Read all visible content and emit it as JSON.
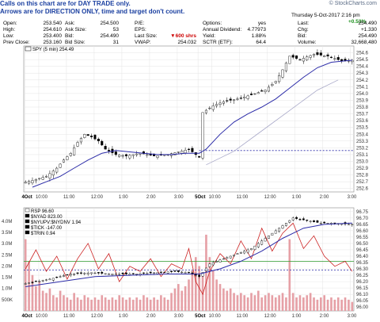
{
  "banner": {
    "line1": "Calls on this chart are for DAY TRADE only.",
    "line2": "Arrows are for DIRECTION ONLY, time and target don't count."
  },
  "brand": "© StockCharts.com",
  "quote": {
    "date": "Thursday  5-Oct-2017  2:16 pm",
    "change_pct": "+0.53%",
    "rows": [
      {
        "l1": "Open:",
        "v1": "253.540",
        "l2": "Ask:",
        "v2": "254.500",
        "l3": "P/E:",
        "v3": "",
        "l4": "Options:",
        "v4": "yes",
        "l5": "Last:",
        "v5": "254.490"
      },
      {
        "l1": "High:",
        "v1": "254.610",
        "l2": "Ask Size:",
        "v2": "53",
        "l3": "EPS:",
        "v3": "",
        "l4": "Annual Dividend:",
        "v4": "4.77973",
        "l5": "Chg:",
        "v5": "+1.330"
      },
      {
        "l1": "Low:",
        "v1": "253.400",
        "l2": "Bid:",
        "v2": "254.490",
        "l3": "Last Size:",
        "v3": "600 shrs",
        "l4": "Yield:",
        "v4": "1.88%",
        "l5": "Bid:",
        "v5": "254.490"
      },
      {
        "l1": "Prev Close:",
        "v1": "253.160",
        "l2": "Bid Size:",
        "v2": "31",
        "l3": "VWAP:",
        "v3": "254.032",
        "l4": "SCTR (ETF):",
        "v4": "64.4",
        "l5": "Volume:",
        "v5": "32,668,480"
      }
    ]
  },
  "colors": {
    "ma": "#2c2ca8",
    "prev_close_line": "#2c2ca8",
    "red_line": "#cc2222",
    "green_line": "#2a9a2a",
    "volume": "#e6a0a6",
    "candle_up": "#ffffff",
    "candle_down": "#000000"
  },
  "chart_data": [
    {
      "type": "candlestick",
      "legend": "SPY (5 min) 254.49",
      "ylim": [
        252.55,
        254.7
      ],
      "y_ticks": [
        252.6,
        252.7,
        252.8,
        252.9,
        253.0,
        253.1,
        253.2,
        253.3,
        253.4,
        253.5,
        253.6,
        253.7,
        253.8,
        253.9,
        254.0,
        254.1,
        254.2,
        254.3,
        254.4,
        254.5,
        254.6
      ],
      "x_ticks": [
        "4Oct",
        "10:00",
        "11:00",
        "12:00",
        "1:00",
        "2:00",
        "3:00",
        "5Oct",
        "10:00",
        "11:00",
        "12:00",
        "1:00",
        "2:00",
        "3:00"
      ],
      "prev_close": 253.16,
      "price_path": [
        [
          0,
          252.68
        ],
        [
          3,
          252.72
        ],
        [
          7,
          252.78
        ],
        [
          10,
          252.9
        ],
        [
          12,
          253.02
        ],
        [
          14,
          253.12
        ],
        [
          16,
          253.28
        ],
        [
          18,
          253.4
        ],
        [
          20,
          253.36
        ],
        [
          22,
          253.3
        ],
        [
          24,
          253.18
        ],
        [
          27,
          253.1
        ],
        [
          30,
          253.08
        ],
        [
          34,
          253.12
        ],
        [
          38,
          253.08
        ],
        [
          42,
          253.1
        ],
        [
          45,
          253.14
        ],
        [
          48,
          253.18
        ],
        [
          51,
          253.06
        ],
        [
          52,
          253.72
        ],
        [
          55,
          253.82
        ],
        [
          58,
          253.88
        ],
        [
          62,
          253.92
        ],
        [
          66,
          253.98
        ],
        [
          70,
          254.05
        ],
        [
          73,
          254.18
        ],
        [
          75,
          254.35
        ],
        [
          77,
          254.55
        ],
        [
          80,
          254.5
        ],
        [
          84,
          254.58
        ],
        [
          88,
          254.55
        ],
        [
          92,
          254.48
        ],
        [
          94,
          254.49
        ]
      ],
      "ma_path": [
        [
          2,
          252.62
        ],
        [
          6,
          252.7
        ],
        [
          10,
          252.78
        ],
        [
          14,
          252.9
        ],
        [
          18,
          253.02
        ],
        [
          22,
          253.12
        ],
        [
          26,
          253.16
        ],
        [
          30,
          253.14
        ],
        [
          34,
          253.12
        ],
        [
          38,
          253.1
        ],
        [
          42,
          253.1
        ],
        [
          46,
          253.12
        ],
        [
          50,
          253.12
        ],
        [
          52,
          253.18
        ],
        [
          56,
          253.4
        ],
        [
          60,
          253.58
        ],
        [
          64,
          253.7
        ],
        [
          68,
          253.8
        ],
        [
          72,
          253.92
        ],
        [
          76,
          254.08
        ],
        [
          80,
          254.24
        ],
        [
          84,
          254.38
        ],
        [
          88,
          254.46
        ],
        [
          92,
          254.48
        ],
        [
          94,
          254.49
        ]
      ],
      "ma_shadow_path": [
        [
          52,
          252.95
        ],
        [
          60,
          253.15
        ],
        [
          68,
          253.45
        ],
        [
          76,
          253.75
        ],
        [
          84,
          254.05
        ],
        [
          90,
          254.2
        ]
      ]
    },
    {
      "type": "line",
      "legend": [
        "RSP 96.60",
        "$NYAD 823.00",
        "$NYUPV:$NYDNV 1.94",
        "$TICK -147.00",
        "$TRIN 0.94"
      ],
      "ylim": [
        95.97,
        96.78
      ],
      "y_ticks": [
        96.0,
        96.05,
        96.1,
        96.15,
        96.2,
        96.25,
        96.3,
        96.35,
        96.4,
        96.45,
        96.5,
        96.55,
        96.6,
        96.65,
        96.7,
        96.75
      ],
      "left_ticks": [
        "500K",
        "1.0M",
        "1.5M",
        "2.0M",
        "2.5M",
        "3.0M",
        "3.5M",
        "4.0M"
      ],
      "x_ticks": [
        "4Oct",
        "10:00",
        "11:00",
        "12:00",
        "1:00",
        "2:00",
        "3:00",
        "5Oct",
        "10:00",
        "11:00",
        "12:00",
        "1:00",
        "2:00",
        "3:00"
      ],
      "green_level": 96.36,
      "blue_level": 96.29,
      "rsp_path": [
        [
          0,
          96.18
        ],
        [
          8,
          96.22
        ],
        [
          14,
          96.26
        ],
        [
          20,
          96.27
        ],
        [
          26,
          96.26
        ],
        [
          32,
          96.26
        ],
        [
          38,
          96.27
        ],
        [
          44,
          96.28
        ],
        [
          48,
          96.27
        ],
        [
          51,
          96.24
        ],
        [
          54,
          96.34
        ],
        [
          60,
          96.4
        ],
        [
          66,
          96.46
        ],
        [
          70,
          96.54
        ],
        [
          74,
          96.62
        ],
        [
          78,
          96.7
        ],
        [
          82,
          96.68
        ],
        [
          86,
          96.66
        ],
        [
          90,
          96.66
        ],
        [
          94,
          96.65
        ]
      ],
      "ma_path": [
        [
          0,
          96.16
        ],
        [
          10,
          96.2
        ],
        [
          20,
          96.24
        ],
        [
          30,
          96.25
        ],
        [
          40,
          96.26
        ],
        [
          50,
          96.26
        ],
        [
          56,
          96.3
        ],
        [
          62,
          96.36
        ],
        [
          68,
          96.44
        ],
        [
          74,
          96.54
        ],
        [
          80,
          96.62
        ],
        [
          86,
          96.65
        ],
        [
          94,
          96.66
        ]
      ],
      "red_path": [
        [
          0,
          96.3
        ],
        [
          3,
          96.45
        ],
        [
          6,
          96.28
        ],
        [
          9,
          96.4
        ],
        [
          12,
          96.22
        ],
        [
          15,
          96.38
        ],
        [
          18,
          96.5
        ],
        [
          21,
          96.3
        ],
        [
          24,
          96.42
        ],
        [
          27,
          96.2
        ],
        [
          30,
          96.32
        ],
        [
          33,
          96.28
        ],
        [
          36,
          96.38
        ],
        [
          39,
          96.24
        ],
        [
          42,
          96.34
        ],
        [
          45,
          96.3
        ],
        [
          47,
          96.46
        ],
        [
          49,
          96.2
        ],
        [
          51,
          96.1
        ],
        [
          53,
          96.28
        ],
        [
          56,
          96.42
        ],
        [
          59,
          96.34
        ],
        [
          62,
          96.52
        ],
        [
          65,
          96.38
        ],
        [
          68,
          96.62
        ],
        [
          71,
          96.44
        ],
        [
          74,
          96.58
        ],
        [
          77,
          96.66
        ],
        [
          80,
          96.46
        ],
        [
          83,
          96.56
        ],
        [
          86,
          96.4
        ],
        [
          89,
          96.32
        ],
        [
          92,
          96.36
        ],
        [
          94,
          96.28
        ]
      ],
      "volume": [
        3.2,
        2.2,
        1.6,
        1.1,
        1.3,
        0.9,
        0.8,
        1.0,
        0.7,
        0.6,
        0.9,
        0.7,
        0.6,
        0.5,
        0.8,
        0.6,
        0.5,
        0.7,
        0.6,
        0.5,
        0.6,
        0.5,
        0.7,
        0.6,
        0.5,
        0.6,
        0.5,
        0.7,
        0.6,
        0.5,
        0.6,
        0.5,
        0.6,
        0.5,
        0.7,
        0.6,
        0.5,
        0.6,
        0.5,
        0.7,
        0.6,
        0.5,
        0.8,
        1.0,
        1.2,
        0.9,
        1.1,
        1.4,
        1.8,
        2.4,
        2.0,
        1.6,
        3.4,
        2.4,
        1.8,
        1.4,
        1.2,
        1.0,
        0.9,
        1.0,
        0.8,
        0.7,
        0.8,
        0.7,
        0.6,
        0.8,
        0.7,
        0.9,
        0.6,
        0.7,
        0.8,
        0.7,
        0.6,
        0.7,
        0.8,
        0.6,
        3.2,
        0.8,
        0.6,
        0.7,
        0.6,
        0.7,
        0.8,
        0.6,
        0.5,
        0.6,
        0.7,
        0.5,
        0.6,
        0.5,
        0.6,
        0.5,
        0.6,
        0.5,
        0.4
      ],
      "day_marker": 50.5
    }
  ]
}
